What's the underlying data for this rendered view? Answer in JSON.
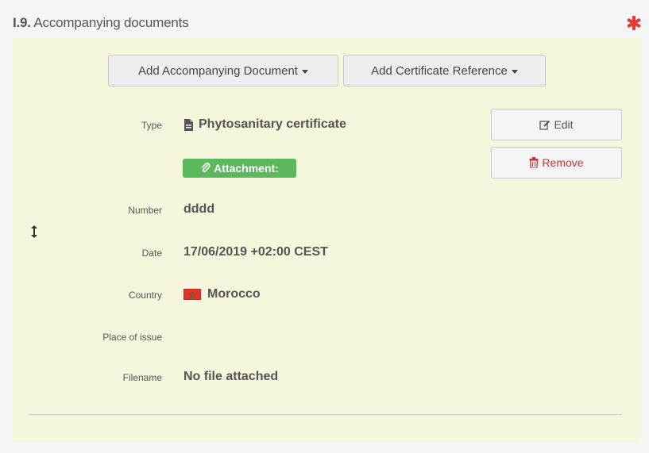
{
  "section": {
    "number": "I.9.",
    "title": "Accompanying documents",
    "required_color": "#e53935"
  },
  "buttons": {
    "add_accompanying_document": "Add Accompanying Document",
    "add_certificate_reference": "Add Certificate Reference",
    "edit": "Edit",
    "remove": "Remove"
  },
  "document": {
    "type_label": "Type",
    "type_value": "Phytosanitary certificate",
    "attachment_badge": "Attachment:",
    "number_label": "Number",
    "number_value": "dddd",
    "date_label": "Date",
    "date_value": "17/06/2019 +02:00 CEST",
    "country_label": "Country",
    "country_value": "Morocco",
    "place_of_issue_label": "Place of issue",
    "place_of_issue_value": "",
    "filename_label": "Filename",
    "filename_value": "No file attached"
  },
  "icons": {
    "required": "asterisk-icon",
    "file": "file-text-icon",
    "attachment": "paperclip-icon",
    "edit": "edit-icon",
    "remove": "trash-icon",
    "sort": "vertical-resize-icon",
    "flag": "morocco-flag-icon"
  },
  "colors": {
    "panel_body_background": "#f6f6dc",
    "attachment_badge": "#5cb85c",
    "remove_text": "#cc3333"
  }
}
